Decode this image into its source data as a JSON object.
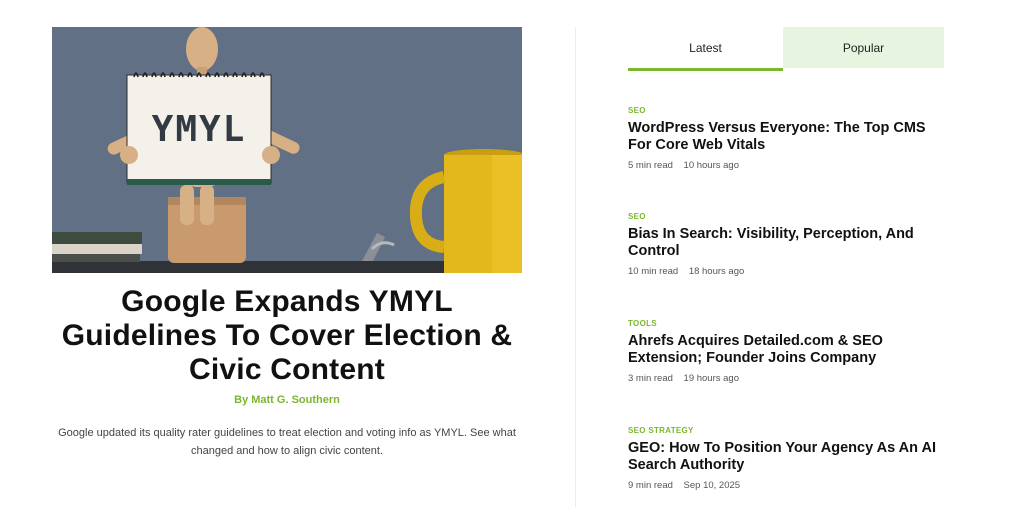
{
  "hero": {
    "sign_text": "YMYL"
  },
  "featured": {
    "title": "Google Expands YMYL Guidelines To Cover Election & Civic Content",
    "author": "By Matt G. Southern",
    "excerpt": "Google updated its quality rater guidelines to treat election and voting info as YMYL. See what changed and how to align civic content."
  },
  "tabs": [
    {
      "label": "Latest",
      "active": true
    },
    {
      "label": "Popular",
      "active": false
    }
  ],
  "articles": [
    {
      "category": "SEO",
      "title": "WordPress Versus Everyone: The Top CMS For Core Web Vitals",
      "read_time": "5 min read",
      "time": "10 hours ago"
    },
    {
      "category": "SEO",
      "title": "Bias In Search: Visibility, Perception, And Control",
      "read_time": "10 min read",
      "time": "18 hours ago"
    },
    {
      "category": "TOOLS",
      "title": "Ahrefs Acquires Detailed.com & SEO Extension; Founder Joins Company",
      "read_time": "3 min read",
      "time": "19 hours ago"
    },
    {
      "category": "SEO STRATEGY",
      "title": "GEO: How To Position Your Agency As An AI Search Authority",
      "read_time": "9 min read",
      "time": "Sep 10, 2025"
    }
  ],
  "colors": {
    "accent": "#7ab72e",
    "tab_popular_bg": "#e7f4df",
    "hero_wall": "#5f6c80",
    "mug": "#e2b81c"
  }
}
